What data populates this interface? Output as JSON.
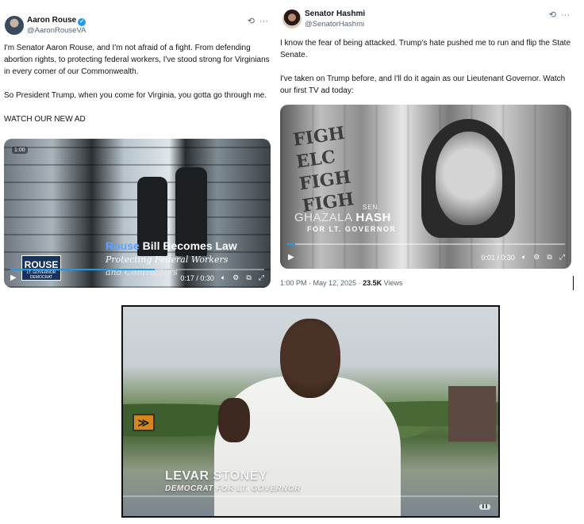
{
  "tweet1": {
    "name": "Aaron Rouse",
    "handle": "@AaronRouseVA",
    "verified_icon": "✓",
    "icons": {
      "grok": "grok-icon",
      "more": "more-icon"
    },
    "paragraphs": [
      "I'm Senator Aaron Rouse, and I'm not afraid of a fight. From defending abortion rights, to protecting federal workers, I've stood strong for Virginians in every corner of our Commonwealth.",
      "So President Trump, when you come for Virginia, you gotta go through me.",
      "WATCH OUR NEW AD"
    ],
    "video": {
      "duration_badge": "1:00",
      "title_accent": "Rouse",
      "title_rest": " Bill Becomes Law",
      "subtitle": "Protecting Federal Workers",
      "subtitle2": "and Contractors",
      "logo_big": "ROUSE",
      "logo_small1": "LT. GOVERNOR",
      "logo_small2": "DEMOCRAT",
      "time": "0:17 / 0:30",
      "progress": 0.57
    }
  },
  "tweet2": {
    "name": "Senator Hashmi",
    "handle": "@SenatorHashmi",
    "icons": {
      "grok": "grok-icon",
      "more": "more-icon"
    },
    "paragraphs": [
      "I know the fear of being attacked. Trump's hate pushed me to run and flip the State Senate.",
      "I've taken on Trump before, and I'll do it again as our Lieutenant Governor. Watch our first TV ad today:"
    ],
    "video": {
      "sign_text": "FIGH\nELC\nFIGH\nFIGH",
      "sen": "SEN.",
      "first_name": "GHAZALA ",
      "last_name": "HASH",
      "for_line": "FOR LT. GOVERNOR",
      "time": "0:01 / 0:30",
      "progress": 0.03
    },
    "meta_time": "1:00 PM · May 12, 2025 · ",
    "views_count": "23.5K",
    "views_label": " Views"
  },
  "video3": {
    "name": "LEVAR STONEY",
    "subtitle": "DEMOCRAT FOR LT. GOVERNOR",
    "sign_glyph": "≫",
    "badge": "❚❚"
  },
  "colors": {
    "accent": "#1d9bf0",
    "rouse_blue": "#5ea2ff",
    "logo_navy": "#16335e"
  }
}
